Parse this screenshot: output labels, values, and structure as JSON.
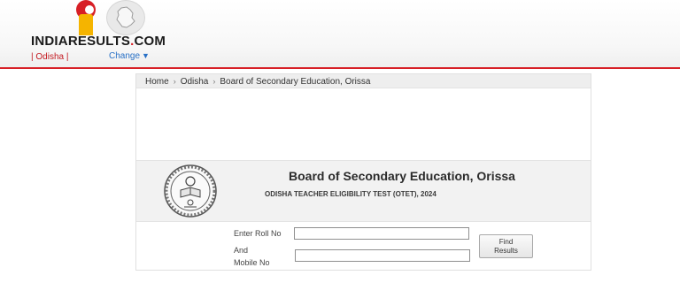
{
  "header": {
    "brand_main": "INDIARΕSULTS",
    "brand_dot": ".",
    "brand_tld": "COM",
    "state_label": "| Odisha  |",
    "change_label": "Change",
    "change_caret": "▼",
    "colors": {
      "accent_red": "#d71f26",
      "accent_yellow": "#f5b400",
      "link_blue": "#2870c6"
    },
    "icons": [
      "indiaresults-logo-icon",
      "odisha-map-icon"
    ]
  },
  "breadcrumb": {
    "items": [
      "Home",
      "Odisha",
      "Board of Secondary Education, Orissa"
    ],
    "separator": "›"
  },
  "board": {
    "title": "Board of Secondary Education, Orissa",
    "exam": "ODISHA TEACHER ELIGIBILITY TEST (OTET), 2024",
    "seal_icon": "board-seal-emblem-icon"
  },
  "form": {
    "roll_label": "Enter Roll No",
    "and_label": "And",
    "mobile_label": "Mobile No",
    "roll_value": "",
    "mobile_value": "",
    "find_label_line1": "Find",
    "find_label_line2": "Results"
  }
}
